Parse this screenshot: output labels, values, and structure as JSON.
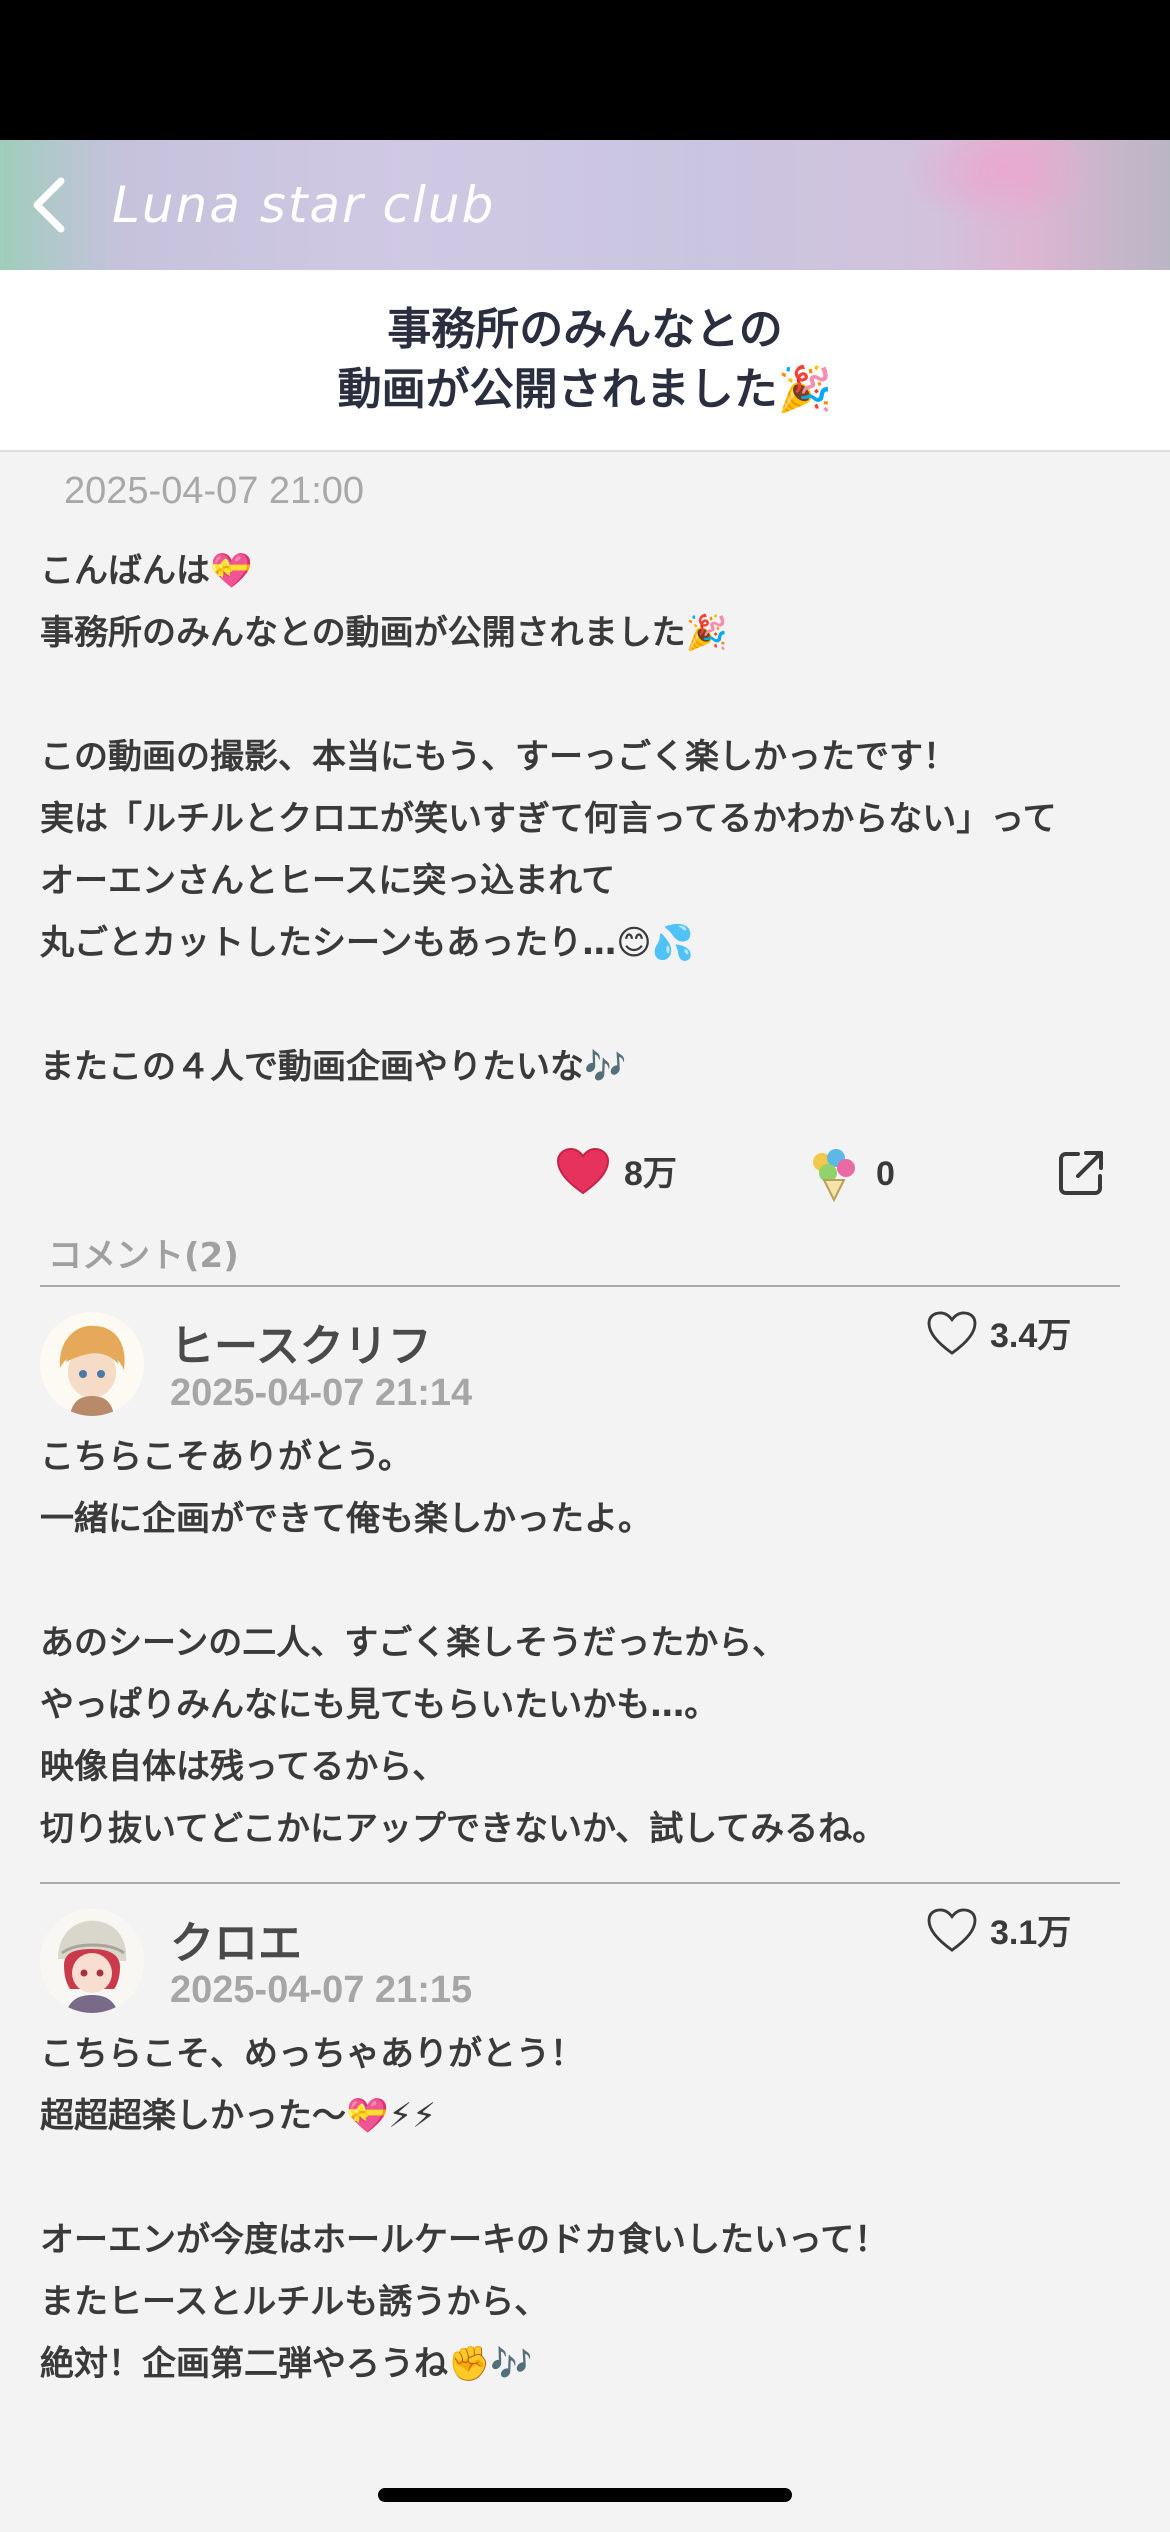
{
  "header": {
    "title": "Luna star club",
    "back_icon": "chevron-left-icon"
  },
  "post": {
    "title_lines": [
      "事務所のみんなとの",
      "動画が公開されました🎉"
    ],
    "date": "2025-04-07 21:00",
    "body_lines": [
      "こんばんは💝",
      "事務所のみんなとの動画が公開されました🎉",
      "",
      "この動画の撮影、本当にもう、すーっごく楽しかったです！",
      "実は「ルチルとクロエが笑いすぎて何言ってるかわからない」って",
      "オーエンさんとヒースに突っ込まれて",
      "丸ごとカットしたシーンもあったり…😊💦",
      "",
      "またこの４人で動画企画やりたいな🎶"
    ],
    "likes": "8万",
    "flowers": "0",
    "like_icon": "heart-filled-icon",
    "flower_icon": "bouquet-icon",
    "share_icon": "share-icon",
    "colors": {
      "heart": "#e8325e"
    }
  },
  "comments_section": {
    "label": "コメント(2)",
    "items": [
      {
        "name": "ヒースクリフ",
        "date": "2025-04-07 21:14",
        "likes": "3.4万",
        "body_lines": [
          "こちらこそありがとう。",
          "一緒に企画ができて俺も楽しかったよ。",
          "",
          "あのシーンの二人、すごく楽しそうだったから、",
          "やっぱりみんなにも見てもらいたいかも…。",
          "映像自体は残ってるから、",
          "切り抜いてどこかにアップできないか、試してみるね。"
        ]
      },
      {
        "name": "クロエ",
        "date": "2025-04-07 21:15",
        "likes": "3.1万",
        "body_lines": [
          "こちらこそ、めっちゃありがとう！",
          "超超超楽しかった～💝⚡⚡",
          "",
          "オーエンが今度はホールケーキのドカ食いしたいって！",
          "またヒースとルチルも誘うから、",
          "絶対！企画第二弾やろうね✊🎶"
        ]
      }
    ]
  }
}
